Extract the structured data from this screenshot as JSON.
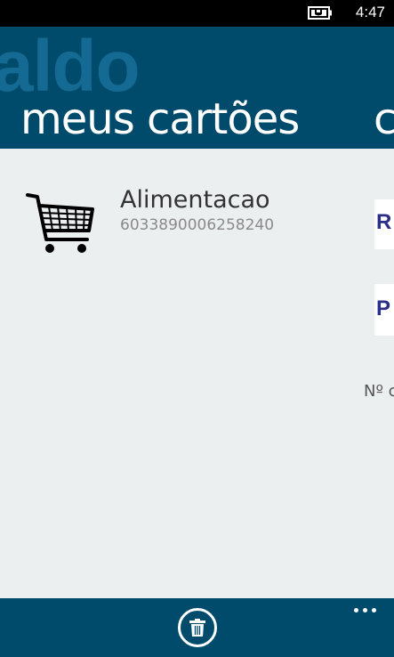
{
  "status_bar": {
    "time": "4:47",
    "battery_icon": "battery-charging-icon"
  },
  "header": {
    "panorama_title": "aldo",
    "section_title": "meus cartões",
    "next_section_peek": "c"
  },
  "cards": [
    {
      "icon": "shopping-cart-icon",
      "name": "Alimentacao",
      "number": "6033890006258240"
    }
  ],
  "peek": {
    "logo_1": "R",
    "logo_2": "P",
    "text": "Nº c"
  },
  "app_bar": {
    "delete_icon": "trash-icon",
    "more_icon": "ellipsis-icon"
  },
  "colors": {
    "accent": "#004b6c",
    "panorama_title": "#146a93",
    "background": "#eceff0"
  }
}
